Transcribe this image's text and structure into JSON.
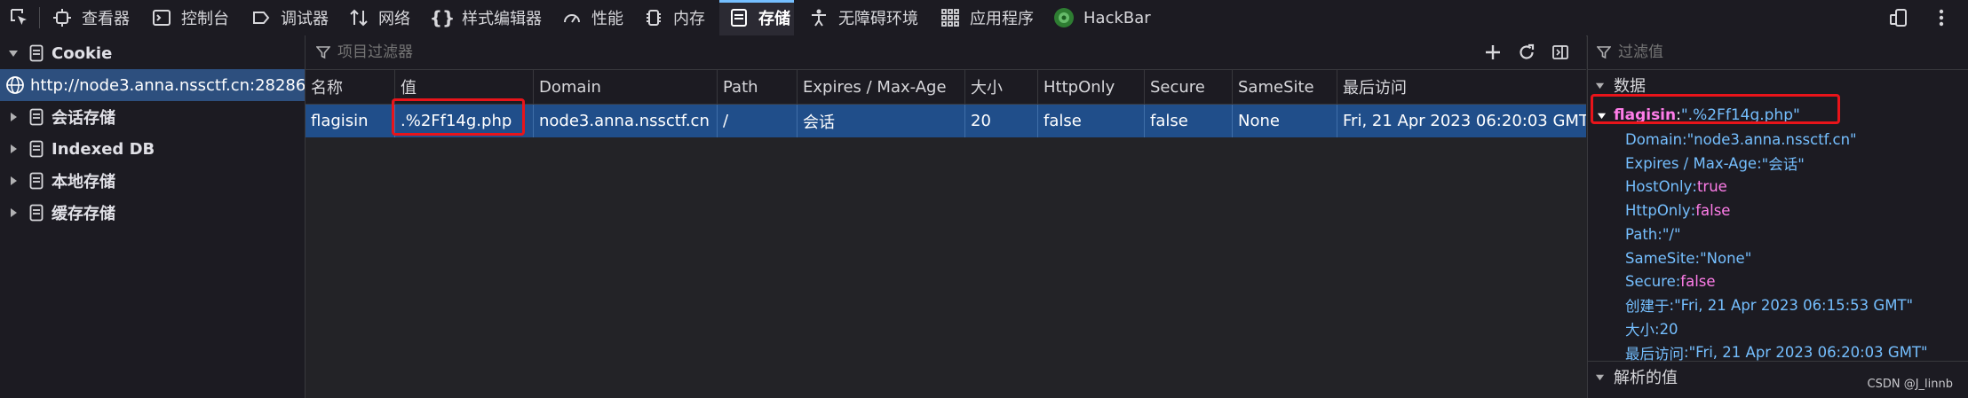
{
  "toolbar": {
    "tabs": [
      {
        "label": "查看器",
        "icon": "inspector-icon"
      },
      {
        "label": "控制台",
        "icon": "console-icon"
      },
      {
        "label": "调试器",
        "icon": "debugger-icon"
      },
      {
        "label": "网络",
        "icon": "network-icon"
      },
      {
        "label": "样式编辑器",
        "icon": "style-editor-icon"
      },
      {
        "label": "性能",
        "icon": "performance-icon"
      },
      {
        "label": "内存",
        "icon": "memory-icon"
      },
      {
        "label": "存储",
        "icon": "storage-icon",
        "active": true
      },
      {
        "label": "无障碍环境",
        "icon": "accessibility-icon"
      },
      {
        "label": "应用程序",
        "icon": "application-icon"
      },
      {
        "label": "HackBar",
        "icon": "hackbar-icon"
      }
    ]
  },
  "tree": {
    "items": [
      {
        "label": "Cookie",
        "expanded": true
      },
      {
        "label": "http://node3.anna.nssctf.cn:28286",
        "selected": true
      },
      {
        "label": "会话存储"
      },
      {
        "label": "Indexed DB"
      },
      {
        "label": "本地存储"
      },
      {
        "label": "缓存存储"
      }
    ]
  },
  "table": {
    "filter_placeholder": "项目过滤器",
    "columns": [
      "名称",
      "值",
      "Domain",
      "Path",
      "Expires / Max-Age",
      "大小",
      "HttpOnly",
      "Secure",
      "SameSite",
      "最后访问"
    ],
    "rows": [
      [
        "flagisin",
        ".%2Ff14g.php",
        "node3.anna.nssctf.cn",
        "/",
        "会话",
        "20",
        "false",
        "false",
        "None",
        "Fri, 21 Apr 2023 06:20:03 GMT"
      ]
    ]
  },
  "sidebar": {
    "filter_placeholder": "过滤值",
    "data_header": "数据",
    "root_key": "flagisin",
    "root_value": "\".%2Ff14g.php\"",
    "props": [
      {
        "key": "Domain",
        "value": "\"node3.anna.nssctf.cn\"",
        "kind": "str"
      },
      {
        "key": "Expires / Max-Age",
        "value": "\"会话\"",
        "kind": "str"
      },
      {
        "key": "HostOnly",
        "value": "true",
        "kind": "bool"
      },
      {
        "key": "HttpOnly",
        "value": "false",
        "kind": "bool"
      },
      {
        "key": "Path",
        "value": "\"/\"",
        "kind": "str"
      },
      {
        "key": "SameSite",
        "value": "\"None\"",
        "kind": "str"
      },
      {
        "key": "Secure",
        "value": "false",
        "kind": "bool"
      },
      {
        "key": "创建于",
        "value": "\"Fri, 21 Apr 2023 06:15:53 GMT\"",
        "kind": "str"
      },
      {
        "key": "大小",
        "value": "20",
        "kind": "num"
      },
      {
        "key": "最后访问",
        "value": "\"Fri, 21 Apr 2023 06:20:03 GMT\"",
        "kind": "str"
      }
    ],
    "parsed_header": "解析的值"
  },
  "watermark": "CSDN @J_linnb",
  "colors": {
    "accent": "#75bfff",
    "selection": "#204e8a",
    "highlight_box": "#e8141a",
    "bool_value": "#ff7de9"
  }
}
